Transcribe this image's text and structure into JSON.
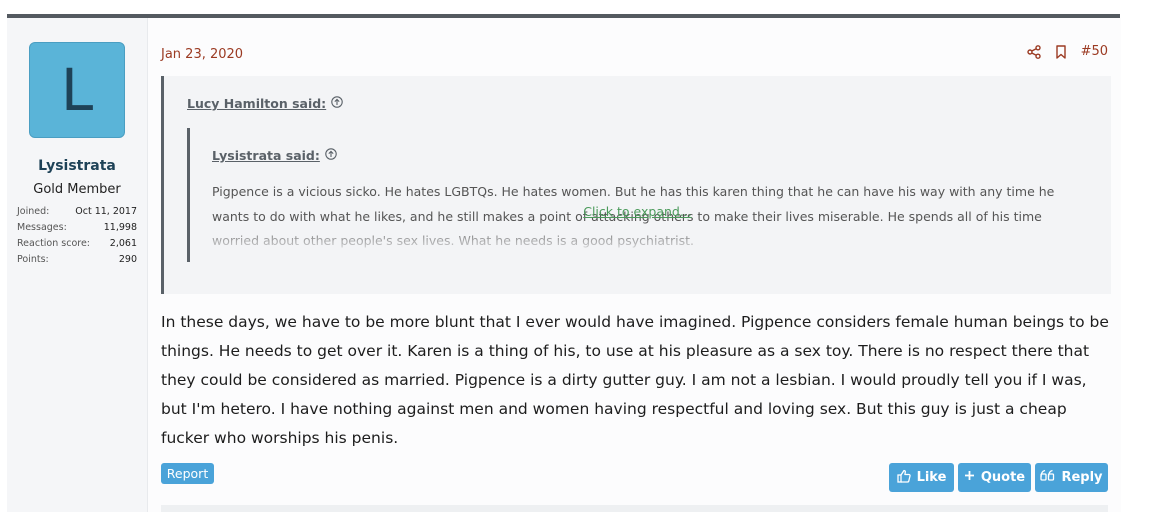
{
  "author": {
    "avatar_letter": "L",
    "avatar_color": "#5ab4d8",
    "name": "Lysistrata",
    "title": "Gold Member",
    "stats": [
      {
        "label": "Joined:",
        "value": "Oct 11, 2017"
      },
      {
        "label": "Messages:",
        "value": "11,998"
      },
      {
        "label": "Reaction score:",
        "value": "2,061"
      },
      {
        "label": "Points:",
        "value": "290"
      }
    ]
  },
  "post": {
    "date": "Jan 23, 2020",
    "number": "#50",
    "share_icon": "share-icon",
    "bookmark_icon": "bookmark-icon"
  },
  "quote_outer": {
    "author_label": "Lucy Hamilton said:"
  },
  "quote_inner": {
    "author_label": "Lysistrata said:",
    "text": "Pigpence is a vicious sicko. He hates LGBTQs. He hates women. But he has this karen thing that he can have his way with any time he wants to do with what he likes, and he still makes a point of attacking others to make their lives miserable. He spends all of his time worried about other people's sex lives. What he needs is a good psychiatrist."
  },
  "expand_label": "Click to expand...",
  "message": "In these days, we have to be more blunt that I ever would have imagined. Pigpence considers female human beings to be things. He needs to get over it. Karen is a thing of his, to use at his pleasure as a sex toy. There is no respect there that they could be considered as married. Pigpence is a dirty gutter guy. I am not a lesbian. I would proudly tell you if I was, but I'm hetero. I have nothing against men and women having respectful and loving sex. But this guy is just a cheap fucker who worships his penis.",
  "buttons": {
    "report": "Report",
    "like": "Like",
    "quote": "Quote",
    "reply": "Reply"
  },
  "colors": {
    "accent": "#4aa3d9",
    "date": "#9b3a22",
    "expand": "#4a9a5a"
  }
}
